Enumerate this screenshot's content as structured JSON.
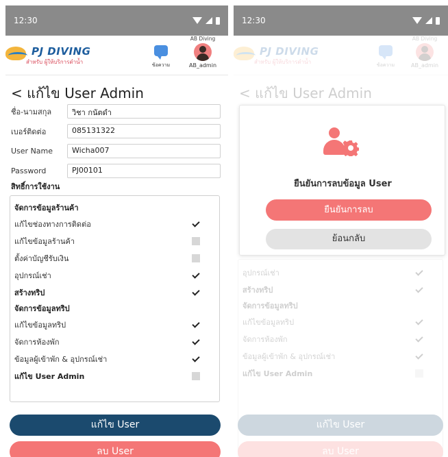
{
  "status": {
    "time": "12:30"
  },
  "brand": {
    "name": "PJ DIVING",
    "tagline": "สำหรับ ผู้ให้บริการดำน้ำ"
  },
  "header": {
    "chat_label": "ข้อความ",
    "user_top": "AB Diving",
    "user_label": "AB_admin"
  },
  "page": {
    "title": "< แก้ไข User Admin"
  },
  "form": {
    "fields": [
      {
        "label": "ชื่อ-นามสกุล",
        "value": "วิชา กนัตดำ"
      },
      {
        "label": "เบอร์ติดต่อ",
        "value": "085131322"
      },
      {
        "label": "User Name",
        "value": "Wicha007"
      },
      {
        "label": "Password",
        "value": "PJ00101"
      }
    ],
    "permissions_heading": "สิทธิ์การใช้งาน"
  },
  "permissions": [
    {
      "label": "จัดการข้อมูลร้านค้า",
      "type": "group"
    },
    {
      "label": "แก้ไขช่องทางการติดต่อ",
      "checked": true
    },
    {
      "label": "แก้ไขข้อมูลร้านค้า",
      "checked": false
    },
    {
      "label": "ตั้งค่าบัญชีรับเงิน",
      "checked": false
    },
    {
      "label": "อุปกรณ์เช่า",
      "checked": true
    },
    {
      "label": "สร้างทริป",
      "checked": true,
      "bold": true
    },
    {
      "label": "จัดการข้อมูลทริป",
      "type": "group"
    },
    {
      "label": "แก้ไขข้อมูลทริป",
      "checked": true
    },
    {
      "label": "จัดการห้องพัก",
      "checked": true
    },
    {
      "label": "ข้อมูลผู้เข้าพัก & อุปกรณ์เช่า",
      "checked": true
    },
    {
      "label": "แก้ไข User Admin",
      "checked": false,
      "bold": true
    }
  ],
  "actions": {
    "edit_label": "แก้ไข User",
    "delete_label": "ลบ User"
  },
  "dialog": {
    "title": "ยืนยันการลบข้อมูล User",
    "confirm_label": "ยืนยันการลบ",
    "back_label": "ย้อนกลับ"
  },
  "colors": {
    "primary": "#1b4a6e",
    "danger": "#f47676",
    "statusbar": "#8a8a8a"
  }
}
